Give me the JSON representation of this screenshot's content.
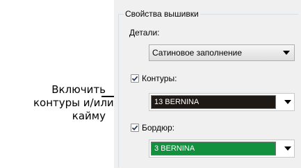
{
  "annotation": {
    "lines": [
      "Включить",
      "контуры и/или",
      "кайму"
    ]
  },
  "panel": {
    "group_title": "Свойства вышивки",
    "details_label": "Детали:",
    "details_select": {
      "value": "Сатиновое заполнение"
    },
    "contours": {
      "label": "Контуры:",
      "checked": true,
      "color_name": "13 BERNINA",
      "color": "#1f1916"
    },
    "border": {
      "label": "Бордюр:",
      "checked": true,
      "color_name": "3 BERNINA",
      "color": "#12903e"
    }
  }
}
